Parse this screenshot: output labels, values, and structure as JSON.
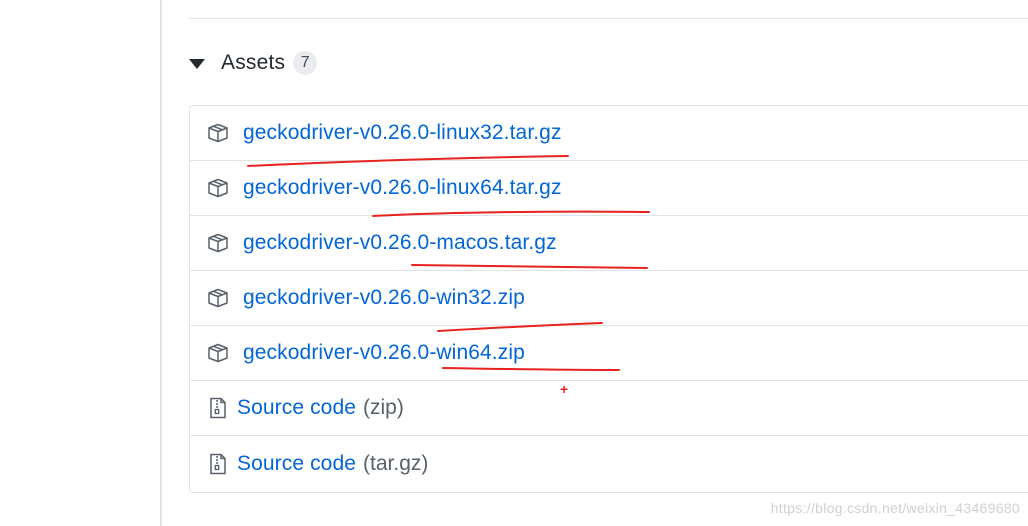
{
  "assets": {
    "title": "Assets",
    "count": "7",
    "items": [
      {
        "label": "geckodriver-v0.26.0-linux32.tar.gz",
        "suffix": "",
        "icon": "package-icon"
      },
      {
        "label": "geckodriver-v0.26.0-linux64.tar.gz",
        "suffix": "",
        "icon": "package-icon"
      },
      {
        "label": "geckodriver-v0.26.0-macos.tar.gz",
        "suffix": "",
        "icon": "package-icon"
      },
      {
        "label": "geckodriver-v0.26.0-win32.zip",
        "suffix": "",
        "icon": "package-icon"
      },
      {
        "label": "geckodriver-v0.26.0-win64.zip",
        "suffix": "",
        "icon": "package-icon"
      },
      {
        "label": "Source code",
        "suffix": "(zip)",
        "icon": "file-zip-icon"
      },
      {
        "label": "Source code",
        "suffix": "(tar.gz)",
        "icon": "file-zip-icon"
      }
    ]
  },
  "annotation": {
    "plus_mark": "+",
    "color": "#e8231f"
  },
  "watermark": "https://blog.csdn.net/weixin_43469680",
  "colors": {
    "link": "#0366d6",
    "border": "#e1e4e8",
    "text": "#24292e"
  }
}
